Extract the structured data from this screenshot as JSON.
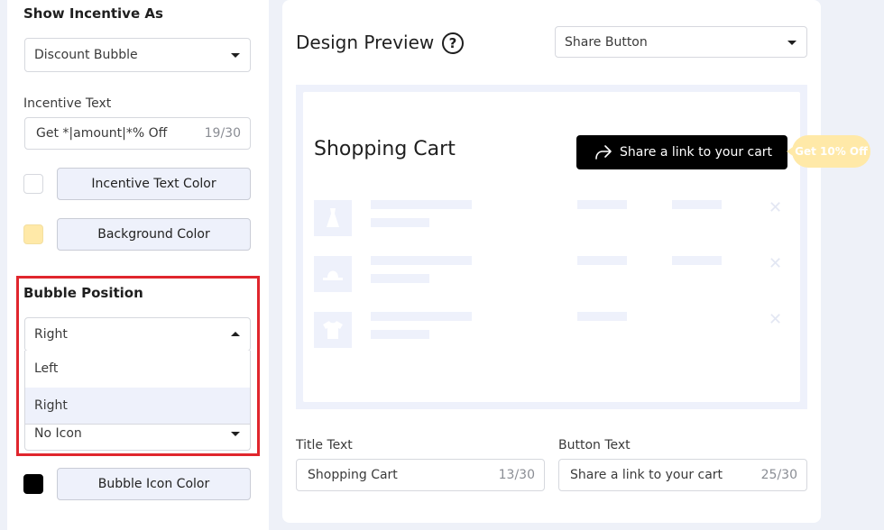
{
  "left": {
    "incentive_section_title": "Show Incentive As",
    "incentive_select_value": "Discount Bubble",
    "incentive_text_label": "Incentive Text",
    "incentive_text_value": "Get *|amount|*% Off",
    "incentive_text_counter": "19/30",
    "incentive_text_color_label": "Incentive Text Color",
    "incentive_text_color": "#ffffff",
    "background_color_label": "Background Color",
    "background_color": "#ffe9a8",
    "bubble_position_title": "Bubble Position",
    "bubble_position_value": "Right",
    "bubble_position_options": [
      "Left",
      "Right"
    ],
    "bubble_icon_value": "No Icon",
    "bubble_icon_color_label": "Bubble Icon Color",
    "bubble_icon_color": "#000000"
  },
  "right": {
    "preview_title": "Design Preview",
    "help_icon_glyph": "?",
    "preview_type_value": "Share Button",
    "cart_title": "Shopping Cart",
    "share_button_label": "Share a link to your cart",
    "bubble_label": "Get 10% Off",
    "title_text_label": "Title Text",
    "title_text_value": "Shopping Cart",
    "title_text_counter": "13/30",
    "button_text_label": "Button Text",
    "button_text_value": "Share a link to your cart",
    "button_text_counter": "25/30"
  },
  "icons": {
    "items": [
      "dress-icon",
      "hat-icon",
      "tshirt-icon"
    ],
    "remove": "✕"
  }
}
